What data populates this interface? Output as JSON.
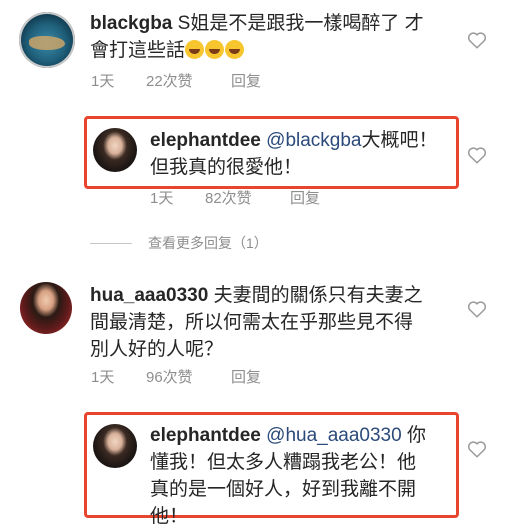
{
  "comments": [
    {
      "username": "blackgba",
      "text_line1": "S姐是不是跟我一樣喝醉了 才",
      "text_line2": "會打這些話",
      "emoji_icon": "laughing-tears-emoji",
      "time": "1天",
      "likes": "22次赞",
      "reply": "回复"
    },
    {
      "username": "elephantdee",
      "mention": "@blackgba",
      "text_line1_rest": "大概吧！",
      "text_line2": "但我真的很愛他！",
      "time": "1天",
      "likes": "82次赞",
      "reply": "回复"
    },
    {
      "view_more": "查看更多回复（1）"
    },
    {
      "username": "hua_aaa0330",
      "text_line1_rest": "夫妻間的關係只有夫妻之",
      "text_line2": "間最清楚，所以何需太在乎那些見不得",
      "text_line3": "別人好的人呢？",
      "time": "1天",
      "likes": "96次赞",
      "reply": "回复"
    },
    {
      "username": "elephantdee",
      "mention": "@hua_aaa0330",
      "text_line1_rest": "你",
      "text_line2": "懂我！但太多人糟蹋我老公！他",
      "text_line3": "真的是一個好人，好到我離不開",
      "text_line4": "他！"
    }
  ],
  "colors": {
    "highlight": "#e8452f",
    "mention": "#2b4a7a",
    "meta": "#8e8e8e"
  }
}
